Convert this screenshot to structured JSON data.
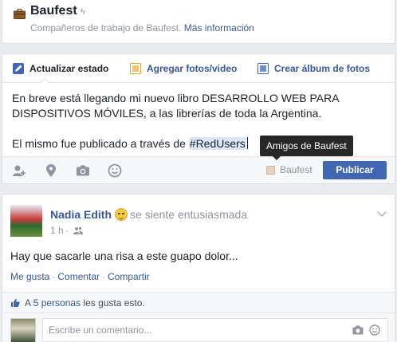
{
  "group": {
    "title": "Baufest",
    "subtitle": "Compañeros de trabajo de Baufest. ",
    "more_link": "Más información"
  },
  "composer": {
    "tabs": [
      {
        "label": "Actualizar estado",
        "icon": "pencil-icon"
      },
      {
        "label": "Agregar fotos/video",
        "icon": "photo-icon"
      },
      {
        "label": "Crear álbum de fotos",
        "icon": "album-icon"
      }
    ],
    "line1": "En breve está llegando mi nuevo libro DESARROLLO WEB PARA DISPOSITIVOS MÓVILES, a las librerías de toda la Argentina.",
    "line2_prefix": "El mismo fue publicado a través de ",
    "hashtag": "#RedUsers",
    "audience": "Baufest",
    "publish_label": "Publicar",
    "tooltip": "Amigos de Baufest",
    "bottom_icons": [
      "tag-friends-icon",
      "location-icon",
      "camera-icon",
      "feeling-icon"
    ]
  },
  "post": {
    "author": "Nadia Edith",
    "feeling": "se siente entusiasmada",
    "time": "1 h",
    "privacy_icon": "friends-icon",
    "text": "Hay que sacarle una risa a este guapo dolor...",
    "actions": [
      "Me gusta",
      "Comentar",
      "Compartir"
    ],
    "likes_prefix": "A ",
    "likes_link": "5 personas",
    "likes_suffix": " les gusta esto.",
    "comment_placeholder": "Escribe un comentario..."
  }
}
